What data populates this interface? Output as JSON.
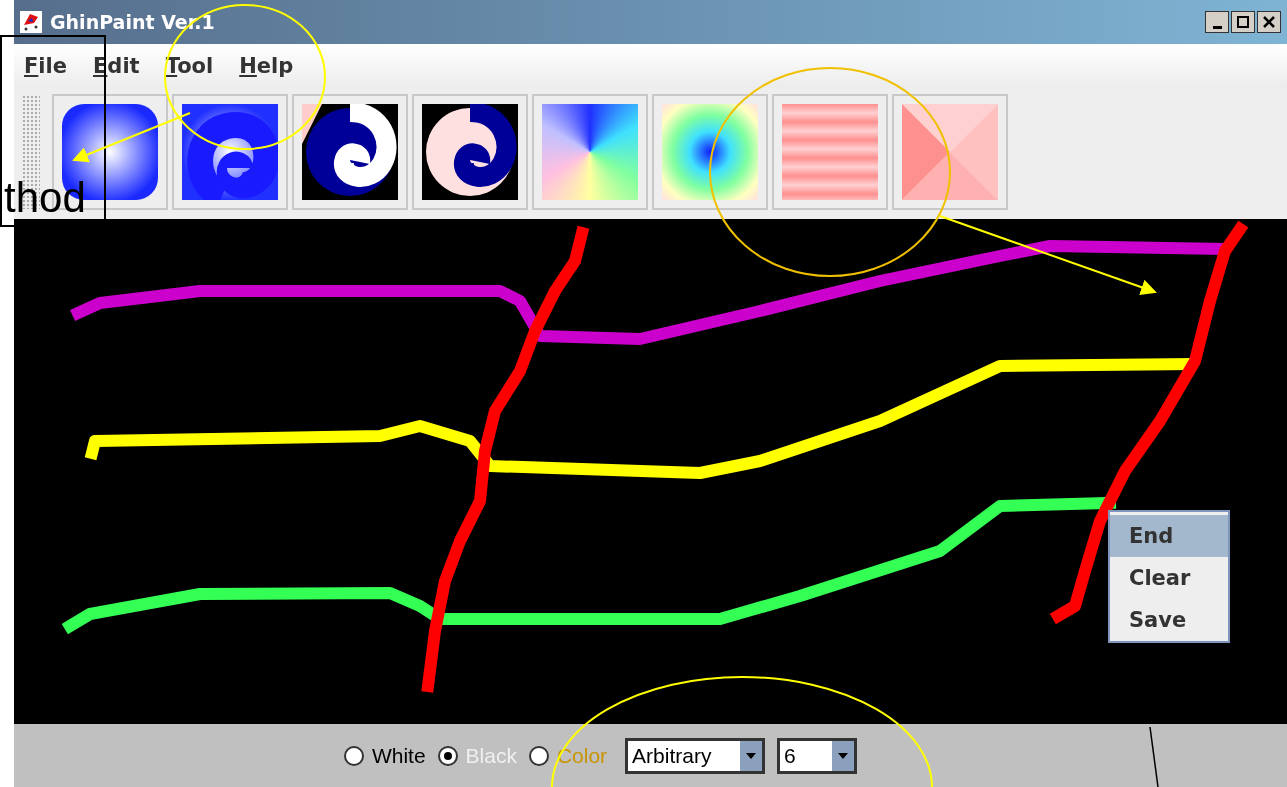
{
  "window": {
    "title": "GhinPaint Ver.1"
  },
  "menu": [
    {
      "label": "File"
    },
    {
      "label": "Edit"
    },
    {
      "label": "Tool"
    },
    {
      "label": "Help"
    }
  ],
  "context_menu": [
    {
      "label": "End",
      "selected": true
    },
    {
      "label": "Clear",
      "selected": false
    },
    {
      "label": "Save",
      "selected": false
    }
  ],
  "background_options": [
    {
      "label": "White",
      "selected": false,
      "color": "#000000"
    },
    {
      "label": "Black",
      "selected": true,
      "color": "#f0f0f0"
    },
    {
      "label": "Color",
      "selected": false,
      "color": "#c89400"
    }
  ],
  "mode_dropdown": {
    "value": "Arbitrary"
  },
  "size_dropdown": {
    "value": "6"
  },
  "annotation": {
    "text": "thod"
  }
}
